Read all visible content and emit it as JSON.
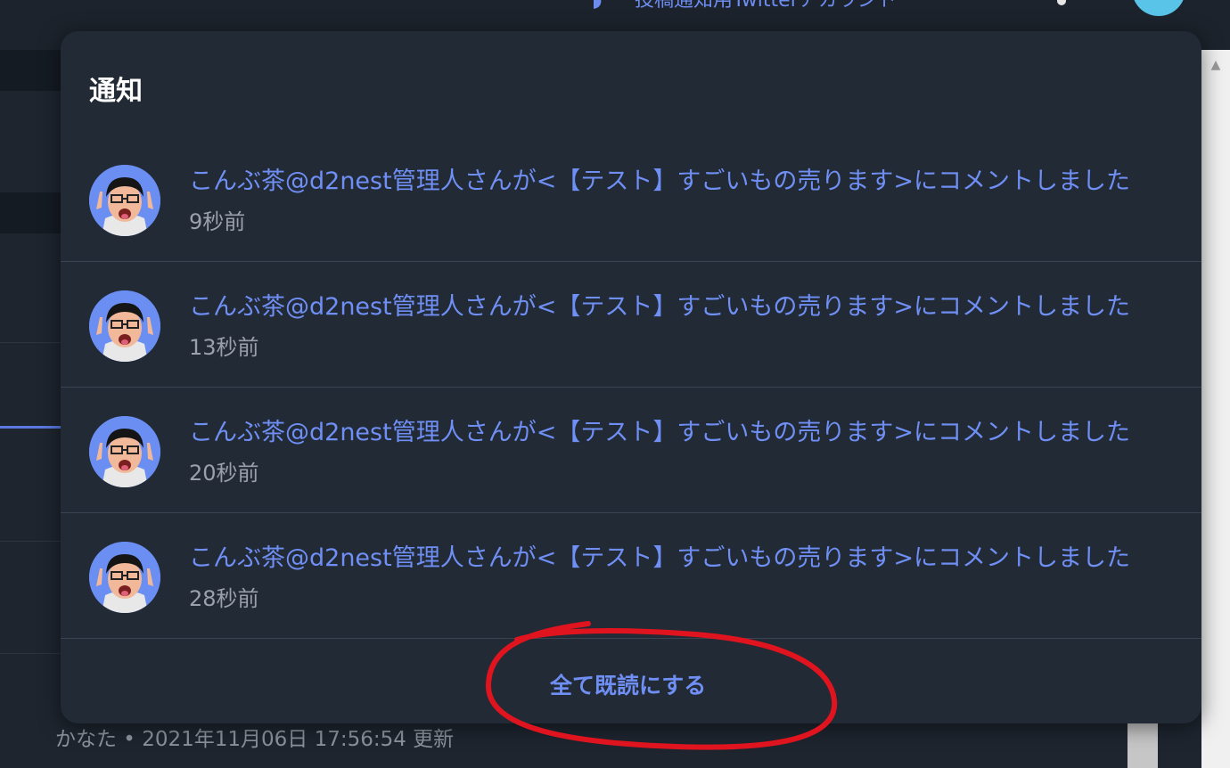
{
  "topbar": {
    "account_label": "投稿通知用Twitterアカウント"
  },
  "background": {
    "meta_text": "かなた • 2021年11月06日 17:56:54 更新"
  },
  "notifications": {
    "title": "通知",
    "items": [
      {
        "message": "こんぶ茶@d2nest管理人さんが<【テスト】すごいもの売ります>にコメントしました",
        "time": "9秒前"
      },
      {
        "message": "こんぶ茶@d2nest管理人さんが<【テスト】すごいもの売ります>にコメントしました",
        "time": "13秒前"
      },
      {
        "message": "こんぶ茶@d2nest管理人さんが<【テスト】すごいもの売ります>にコメントしました",
        "time": "20秒前"
      },
      {
        "message": "こんぶ茶@d2nest管理人さんが<【テスト】すごいもの売ります>にコメントしました",
        "time": "28秒前"
      }
    ],
    "mark_all_read": "全て既読にする"
  },
  "colors": {
    "link": "#6f8ff5",
    "panel_bg": "#222a35",
    "annotation": "#e0141e"
  }
}
